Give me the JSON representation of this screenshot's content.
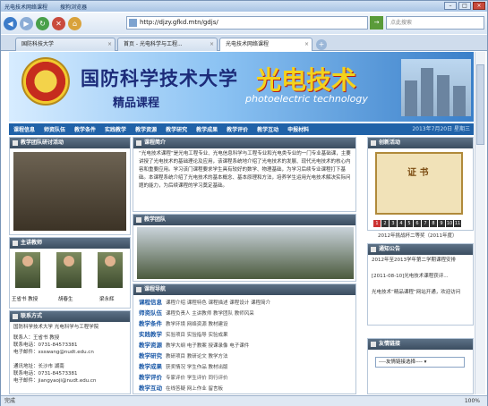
{
  "browser": {
    "title": "光电技术网络课程",
    "menu": "搜狗浏览器",
    "address": "http://djzy.gfkd.mtn/gdjs/",
    "search_placeholder": "点此搜索",
    "tabs": [
      {
        "label": "国防科技大学"
      },
      {
        "label": "首页 - 光电科学与工程..."
      },
      {
        "label": "光电技术网络课程"
      }
    ],
    "status": "完成",
    "zoom": "100%"
  },
  "header": {
    "university": "国防科学技术大学",
    "course_type": "精品课程",
    "course_title": "光电技术",
    "course_subtitle": "photoelectric technology"
  },
  "menu": {
    "items": [
      "课程信息",
      "师资队伍",
      "教学条件",
      "实践教学",
      "教学资源",
      "教学研究",
      "教学成果",
      "教学评价",
      "教学互动",
      "申报材料"
    ],
    "date": "2013年7月20日 星期三"
  },
  "sections": {
    "team_activity": "教学团队研讨活动",
    "intro": "课程简介",
    "innovation": "创新活动",
    "teachers": "主讲教师",
    "team": "教学团队",
    "notice": "通知公告",
    "contact": "联系方式",
    "nav": "课程导航",
    "links": "友情链接"
  },
  "intro_text": "“光电技术课程”是光电工程专业、光电信息科学与工程专业和光电类专业的一门专业基础课，主要讲授了光电技术的基础理论及应用，该课程系统地介绍了光电技术的发展、现代光电技术的核心内容和重要应用。学习该门课程要求学生具有较好的数学、物理基础，为学习后续专业课程打下基础。本课程系统介绍了光电技术的基本概念、基本原理和方法，培养学生运用光电技术解决实际问题的能力，为后续课程的学习奠定基础。",
  "teachers": [
    {
      "name": "王省书 教授"
    },
    {
      "name": "胡春生"
    },
    {
      "name": "梁永辉"
    }
  ],
  "contact": {
    "org": "国防科学技术大学 光电科学与工程学院",
    "lines": [
      "联系人：王省书 教授",
      "联系电话：0731-84573381",
      "电子邮件：xsswang@nudt.edu.cn",
      "",
      "通讯地址：长沙市 湖南",
      "联系电话：0731-84573381",
      "电子邮件：jiangyaoji@nudt.edu.cn"
    ]
  },
  "notice": {
    "items": [
      "2012年至2013学年第二学期课程安排",
      "[2011-08-10]光电技术课程获评...",
      "光电技术“精品课程”网站开通，欢迎访问"
    ]
  },
  "innovation": {
    "cert_text": "证 书",
    "caption": "2012年挑战杯二等奖（2011年度）",
    "pages": [
      "1",
      "2",
      "3",
      "4",
      "5",
      "6",
      "7",
      "8",
      "9",
      "10",
      "11"
    ]
  },
  "nav_rows": [
    {
      "k": "课程信息",
      "v": "课程介绍  课程特色  课程描述  课程设计  课程简介"
    },
    {
      "k": "师资队伍",
      "v": "课程负责人  主讲教师  教学团队  教师风采"
    },
    {
      "k": "教学条件",
      "v": "教学环境  网络资源  教材建设"
    },
    {
      "k": "实践教学",
      "v": "实验项目  实验指导  实验成果"
    },
    {
      "k": "教学资源",
      "v": "教学大纲  电子教案  授课录像  电子课件"
    },
    {
      "k": "教学研究",
      "v": "教研项目  教研论文  教学方法"
    },
    {
      "k": "教学成果",
      "v": "获奖情况  学生作品  教材出版"
    },
    {
      "k": "教学评价",
      "v": "专家评价  学生评价  同行评价"
    },
    {
      "k": "教学互动",
      "v": "在线答疑  网上作业  留言板"
    }
  ],
  "links": {
    "selected": "----友情链接选择----"
  }
}
